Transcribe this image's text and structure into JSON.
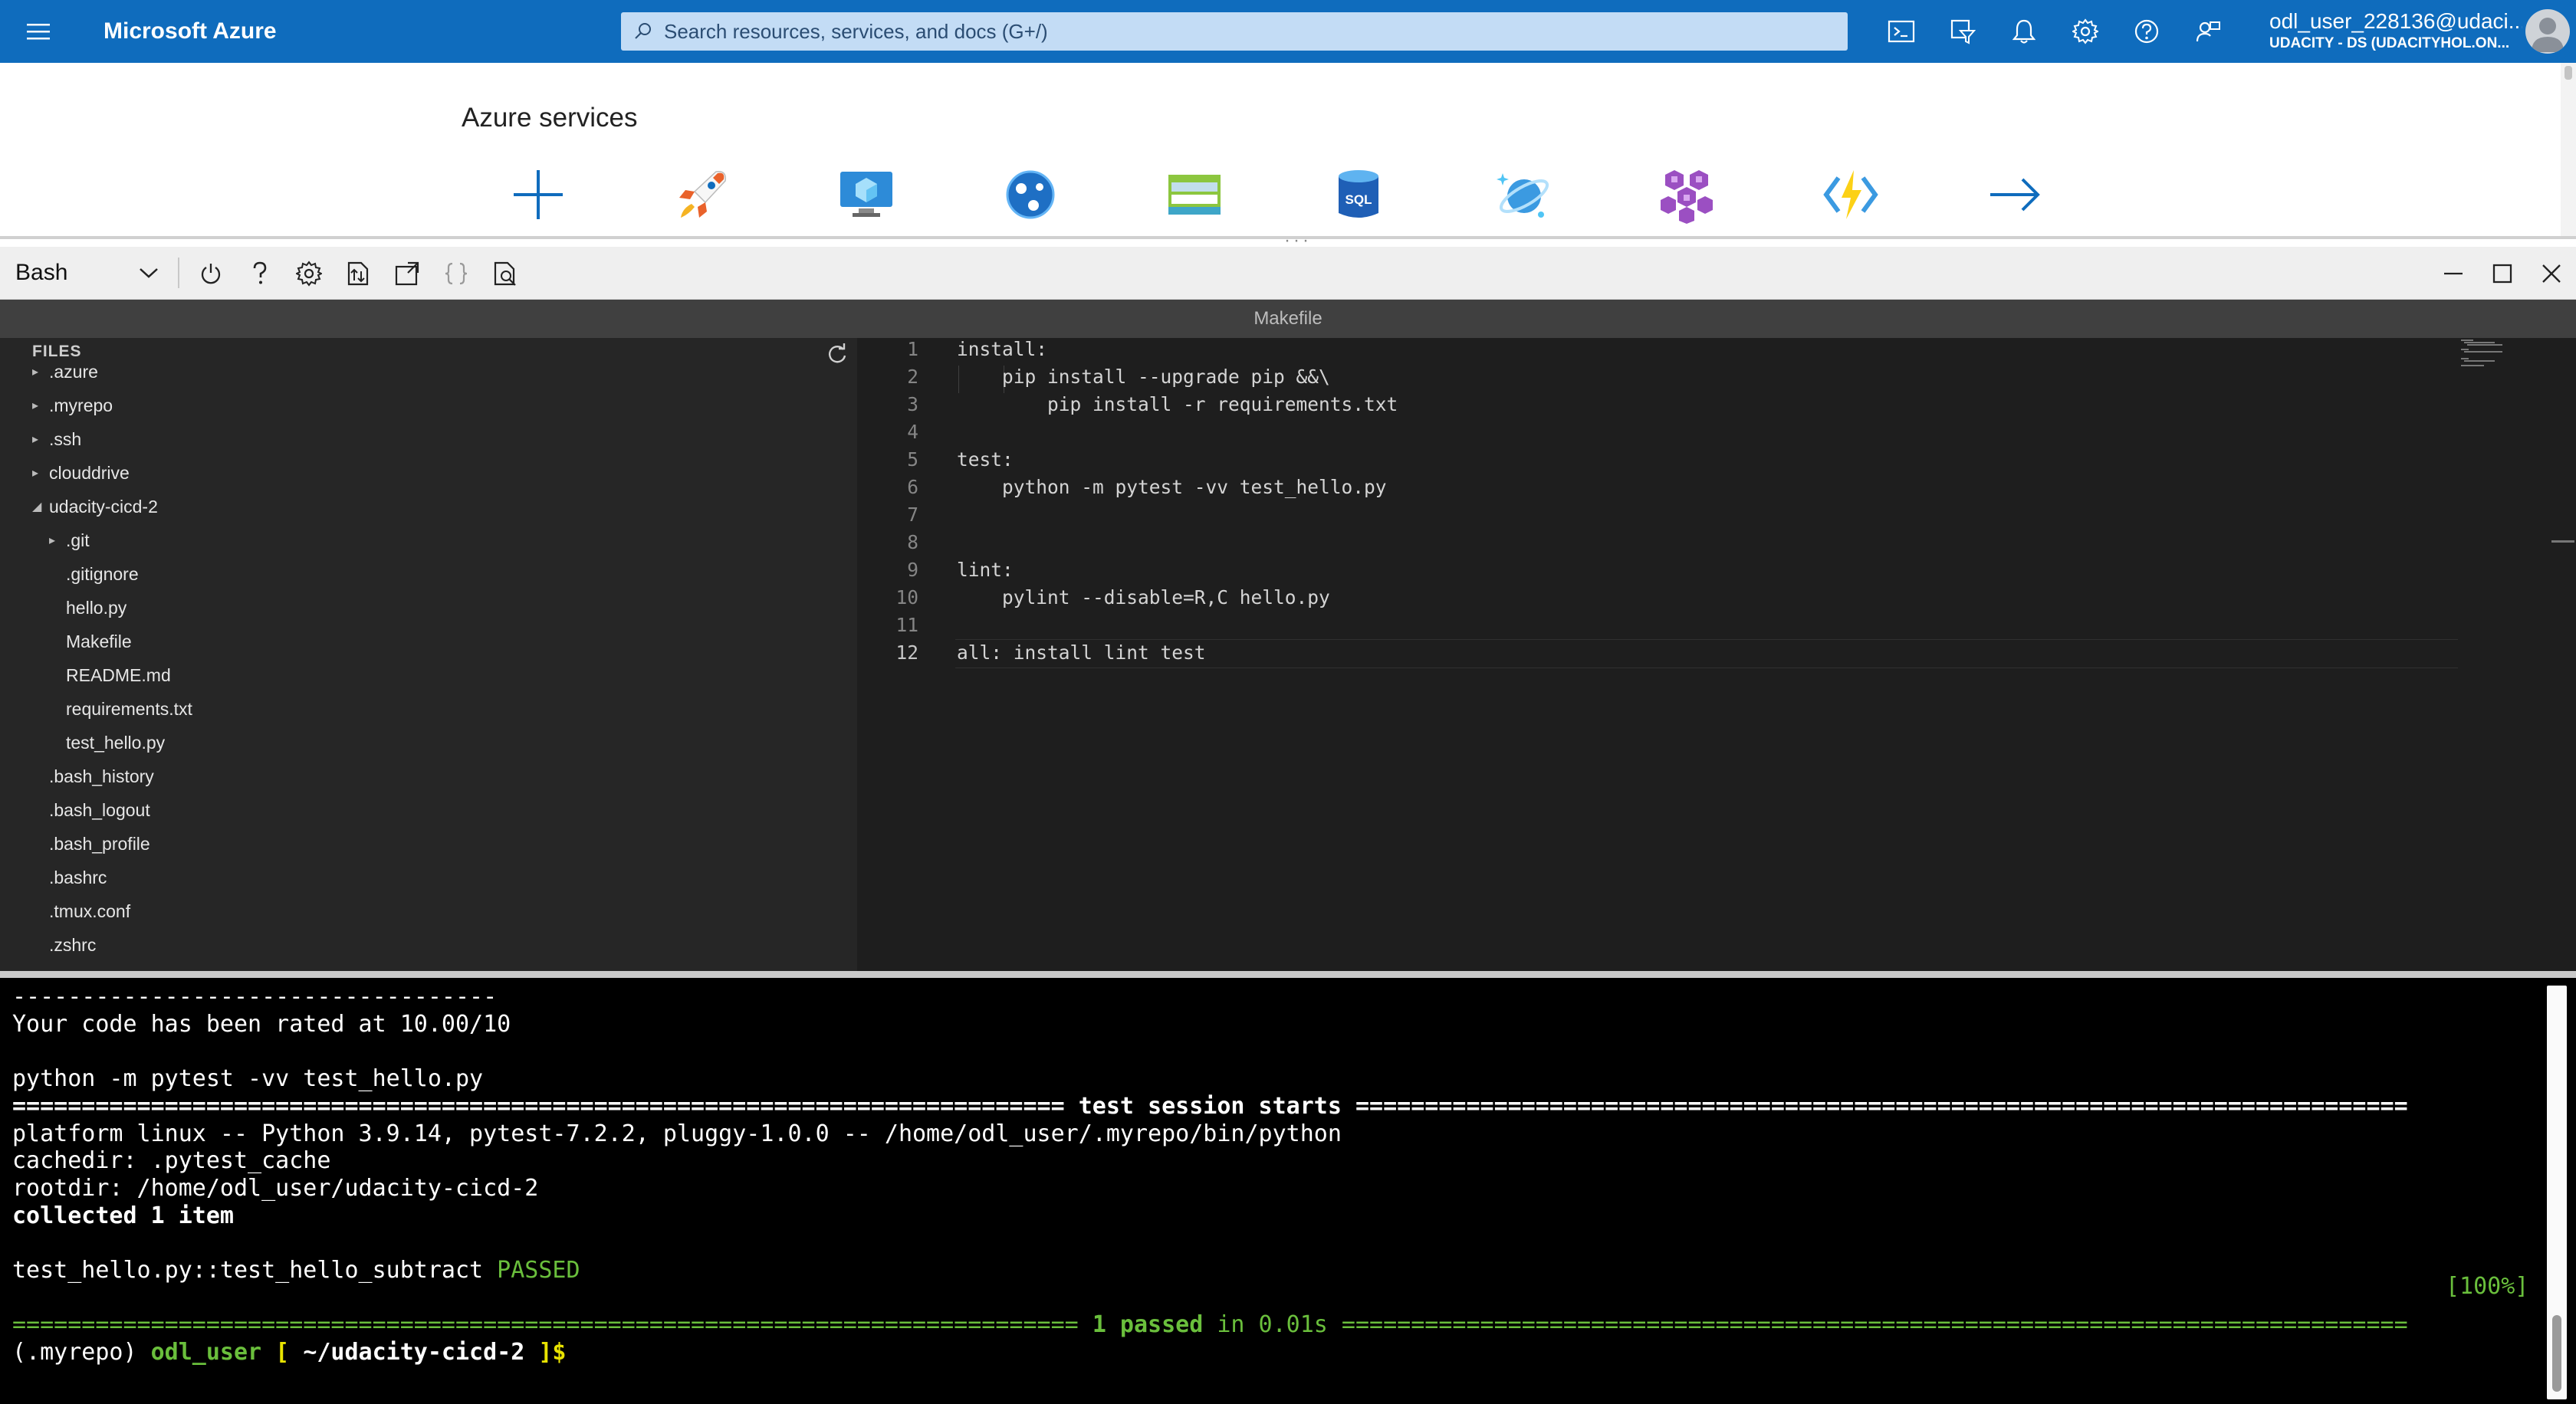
{
  "topbar": {
    "brand": "Microsoft Azure",
    "search_placeholder": "Search resources, services, and docs (G+/)",
    "icons": [
      "cloud-shell-icon",
      "directory-filter-icon",
      "notifications-bell-icon",
      "settings-gear-icon",
      "help-question-icon",
      "feedback-icon"
    ],
    "account": {
      "username": "odl_user_228136@udaci...",
      "tenant": "UDACITY - DS (UDACITYHOL.ON..."
    },
    "color": "#0f6cbd"
  },
  "services": {
    "title": "Azure services",
    "icons": [
      "create-resource-plus-icon",
      "quickstart-rocket-icon",
      "virtual-machine-icon",
      "app-services-globe-icon",
      "storage-account-icon",
      "sql-database-icon",
      "cosmos-db-icon",
      "kubernetes-icon",
      "function-app-icon",
      "more-services-arrow-icon"
    ],
    "sql_label": "SQL"
  },
  "cloudshell": {
    "shell": "Bash",
    "toolbar_icons": [
      "restart-power-icon",
      "help-icon",
      "settings-icon",
      "upload-download-icon",
      "open-new-session-icon",
      "editor-braces-icon",
      "web-preview-icon"
    ],
    "window_icons": [
      "minimize-icon",
      "maximize-icon",
      "close-icon"
    ]
  },
  "editor": {
    "filename": "Makefile",
    "files_header": "FILES",
    "tree": [
      {
        "name": ".azure",
        "depth": 0,
        "expandable": true,
        "expanded": false
      },
      {
        "name": ".myrepo",
        "depth": 0,
        "expandable": true,
        "expanded": false
      },
      {
        "name": ".ssh",
        "depth": 0,
        "expandable": true,
        "expanded": false
      },
      {
        "name": "clouddrive",
        "depth": 0,
        "expandable": true,
        "expanded": false
      },
      {
        "name": "udacity-cicd-2",
        "depth": 0,
        "expandable": true,
        "expanded": true
      },
      {
        "name": ".git",
        "depth": 1,
        "expandable": true,
        "expanded": false
      },
      {
        "name": ".gitignore",
        "depth": 1,
        "expandable": false
      },
      {
        "name": "hello.py",
        "depth": 1,
        "expandable": false
      },
      {
        "name": "Makefile",
        "depth": 1,
        "expandable": false
      },
      {
        "name": "README.md",
        "depth": 1,
        "expandable": false
      },
      {
        "name": "requirements.txt",
        "depth": 1,
        "expandable": false
      },
      {
        "name": "test_hello.py",
        "depth": 1,
        "expandable": false
      },
      {
        "name": ".bash_history",
        "depth": 0,
        "expandable": false
      },
      {
        "name": ".bash_logout",
        "depth": 0,
        "expandable": false
      },
      {
        "name": ".bash_profile",
        "depth": 0,
        "expandable": false
      },
      {
        "name": ".bashrc",
        "depth": 0,
        "expandable": false
      },
      {
        "name": ".tmux.conf",
        "depth": 0,
        "expandable": false
      },
      {
        "name": ".zshrc",
        "depth": 0,
        "expandable": false
      }
    ],
    "code_lines": [
      {
        "n": "1",
        "text": "install:"
      },
      {
        "n": "2",
        "text": "    pip install --upgrade pip &&\\"
      },
      {
        "n": "3",
        "text": "        pip install -r requirements.txt"
      },
      {
        "n": "4",
        "text": ""
      },
      {
        "n": "5",
        "text": "test:"
      },
      {
        "n": "6",
        "text": "    python -m pytest -vv test_hello.py"
      },
      {
        "n": "7",
        "text": ""
      },
      {
        "n": "8",
        "text": ""
      },
      {
        "n": "9",
        "text": "lint:"
      },
      {
        "n": "10",
        "text": "    pylint --disable=R,C hello.py"
      },
      {
        "n": "11",
        "text": ""
      },
      {
        "n": "12",
        "text": "all: install lint test"
      }
    ],
    "active_line": "12"
  },
  "terminal": {
    "lines": [
      [
        {
          "t": "-----------------------------------",
          "c": ""
        }
      ],
      [
        {
          "t": "Your code has been rated at 10.00/10",
          "c": ""
        }
      ],
      [
        {
          "t": "",
          "c": ""
        }
      ],
      [
        {
          "t": "python -m pytest -vv test_hello.py",
          "c": ""
        }
      ],
      [
        {
          "t": "============================================================================ ",
          "c": "bold"
        },
        {
          "t": "test session starts",
          "c": "bold"
        },
        {
          "t": " ============================================================================",
          "c": "bold"
        }
      ],
      [
        {
          "t": "platform linux -- Python 3.9.14, pytest-7.2.2, pluggy-1.0.0 -- /home/odl_user/.myrepo/bin/python",
          "c": ""
        }
      ],
      [
        {
          "t": "cachedir: .pytest_cache",
          "c": ""
        }
      ],
      [
        {
          "t": "rootdir: /home/odl_user/udacity-cicd-2",
          "c": ""
        }
      ],
      [
        {
          "t": "collected 1 item",
          "c": "bold"
        }
      ],
      [
        {
          "t": "",
          "c": ""
        }
      ],
      [
        {
          "t": "test_hello.py::test_hello_subtract ",
          "c": ""
        },
        {
          "t": "PASSED",
          "c": "green"
        }
      ],
      [
        {
          "t": "",
          "c": ""
        }
      ],
      [
        {
          "t": "============================================================================= ",
          "c": "green"
        },
        {
          "t": "1 passed",
          "c": "green-b"
        },
        {
          "t": " in 0.01s",
          "c": "green"
        },
        {
          "t": " =============================================================================",
          "c": "green"
        }
      ],
      [
        {
          "t": "(.myrepo) ",
          "c": ""
        },
        {
          "t": "odl_user",
          "c": "green-b"
        },
        {
          "t": " [ ",
          "c": "yellow-b"
        },
        {
          "t": "~/udacity-cicd-2",
          "c": "bold"
        },
        {
          "t": " ]$",
          "c": "yellow-b"
        }
      ]
    ],
    "progress": "[100%]"
  }
}
